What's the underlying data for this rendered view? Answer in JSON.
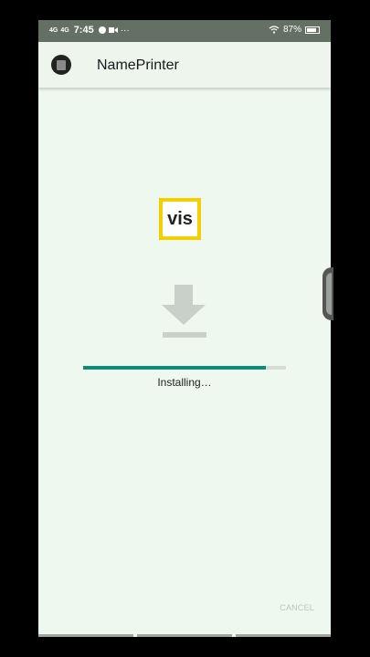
{
  "status_bar": {
    "network_1": "4G",
    "network_2": "4G",
    "time": "7:45",
    "extra": "···",
    "battery_percent": "87%",
    "battery_level": 0.87
  },
  "app_bar": {
    "title": "NamePrinter"
  },
  "logo": {
    "text": "vis",
    "border_color": "#f2d000"
  },
  "install": {
    "status_text": "Installing…",
    "progress": 0.9,
    "progress_color": "#11897a",
    "cancel_label": "CANCEL"
  },
  "icons": {
    "download": "download-icon",
    "wifi": "wifi-icon",
    "battery": "battery-icon",
    "app": "app-icon"
  }
}
